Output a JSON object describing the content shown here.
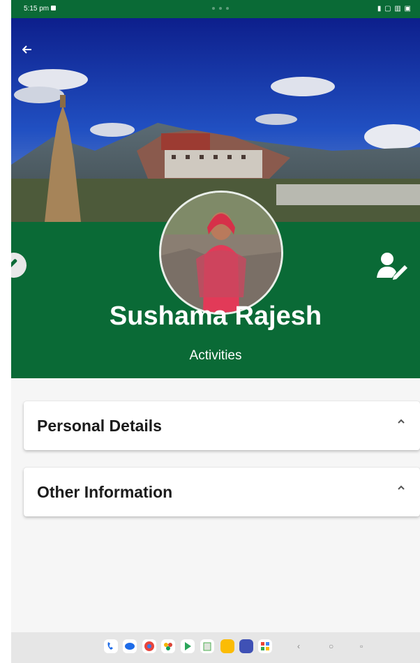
{
  "status_bar": {
    "time": "5:15 pm",
    "right_icons": "▮ ▢ ▥ ▣"
  },
  "header": {
    "back_icon": "arrow-left-icon",
    "name": "Sushama Rajesh",
    "subtitle": "Activities",
    "accent_color": "#0a6a36"
  },
  "sections": [
    {
      "title": "Personal Details",
      "icon": "chevron-up-icon"
    },
    {
      "title": "Other Information",
      "icon": "chevron-up-icon"
    }
  ],
  "dock": {
    "apps": [
      "phone-icon",
      "messages-icon",
      "chrome-icon",
      "photos-icon",
      "play-store-icon",
      "files-icon",
      "notes-icon",
      "browser-icon",
      "app-grid-icon"
    ],
    "nav": [
      "back-nav-icon",
      "home-nav-icon",
      "recents-nav-icon"
    ]
  }
}
